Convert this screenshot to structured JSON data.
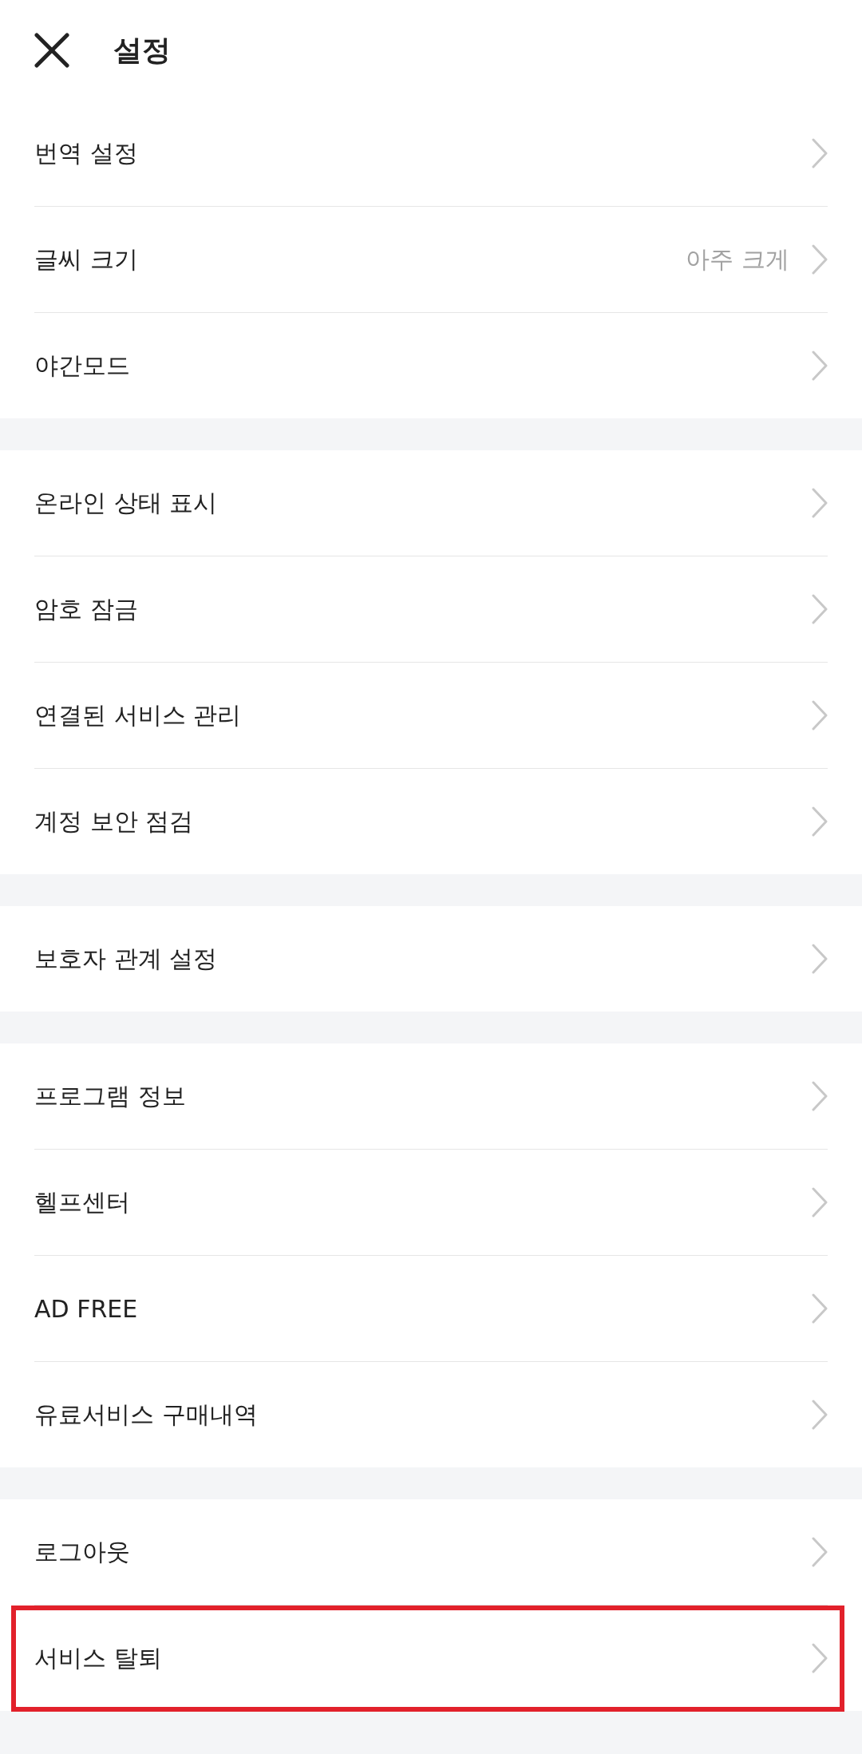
{
  "header": {
    "title": "설정"
  },
  "sections": [
    {
      "items": [
        {
          "label": "번역 설정",
          "highlighted": false
        },
        {
          "label": "글씨 크기",
          "value": "아주 크게",
          "highlighted": false
        },
        {
          "label": "야간모드",
          "highlighted": false
        }
      ]
    },
    {
      "items": [
        {
          "label": "온라인 상태 표시",
          "highlighted": false
        },
        {
          "label": "암호 잠금",
          "highlighted": false
        },
        {
          "label": "연결된 서비스 관리",
          "highlighted": false
        },
        {
          "label": "계정 보안 점검",
          "highlighted": false
        }
      ]
    },
    {
      "items": [
        {
          "label": "보호자 관계 설정",
          "highlighted": false
        }
      ]
    },
    {
      "items": [
        {
          "label": "프로그램 정보",
          "highlighted": false
        },
        {
          "label": "헬프센터",
          "highlighted": false
        },
        {
          "label": "AD FREE",
          "highlighted": false
        },
        {
          "label": "유료서비스 구매내역",
          "highlighted": false
        }
      ]
    },
    {
      "items": [
        {
          "label": "로그아웃",
          "highlighted": false
        },
        {
          "label": "서비스 탈퇴",
          "highlighted": true
        }
      ]
    }
  ]
}
